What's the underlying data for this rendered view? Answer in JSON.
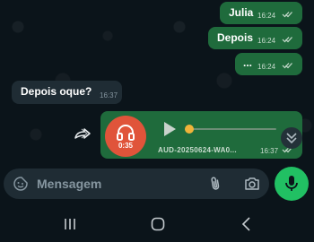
{
  "messages": [
    {
      "text": "Julia",
      "time": "16:24",
      "direction": "outgoing",
      "status": "read"
    },
    {
      "text": "Depois",
      "time": "16:24",
      "direction": "outgoing",
      "status": "read"
    },
    {
      "text": "...",
      "time": "16:24",
      "direction": "outgoing",
      "status": "read"
    },
    {
      "text": "Depois oque?",
      "time": "16:37",
      "direction": "incoming"
    }
  ],
  "audio_message": {
    "duration": "0:35",
    "filename": "AUD-20250624-WA0...",
    "time": "16:37",
    "avatar_icon": "headphones-icon",
    "avatar_color": "#e0543a",
    "progress_fraction": 0.03
  },
  "input": {
    "placeholder": "Mensagem"
  },
  "colors": {
    "outgoing_bubble": "#1f6b3c",
    "incoming_bubble": "#1f2c34",
    "accent": "#21c063",
    "background": "#0b141a"
  }
}
